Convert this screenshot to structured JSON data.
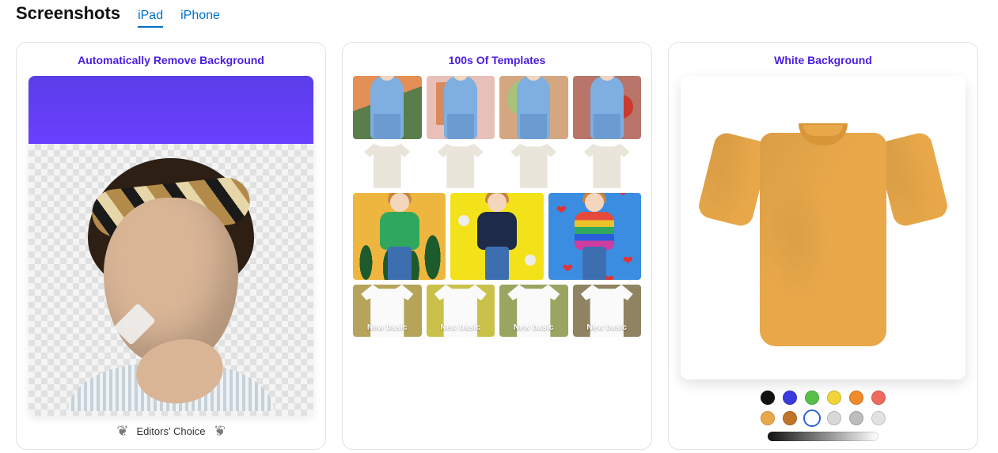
{
  "header": {
    "section_title": "Screenshots",
    "tabs": [
      {
        "label": "iPad",
        "active": true
      },
      {
        "label": "iPhone",
        "active": false
      }
    ]
  },
  "cards": {
    "remove_bg": {
      "title": "Automatically Remove Background",
      "badge": "Editors' Choice"
    },
    "templates": {
      "title": "100s Of Templates",
      "row4_caption": "New basic"
    },
    "white_bg": {
      "title": "White Background",
      "swatches_row1": [
        "#111111",
        "#3a3adf",
        "#58c04a",
        "#f0d43a",
        "#f08a2a",
        "#ef6a5e"
      ],
      "swatches_row2": [
        "#e8a84a",
        "#c0742a",
        "#ffffff",
        "#d8d8d8",
        "#bdbdbd",
        "#e2e2e2"
      ],
      "selected_swatch_index": 2
    }
  }
}
